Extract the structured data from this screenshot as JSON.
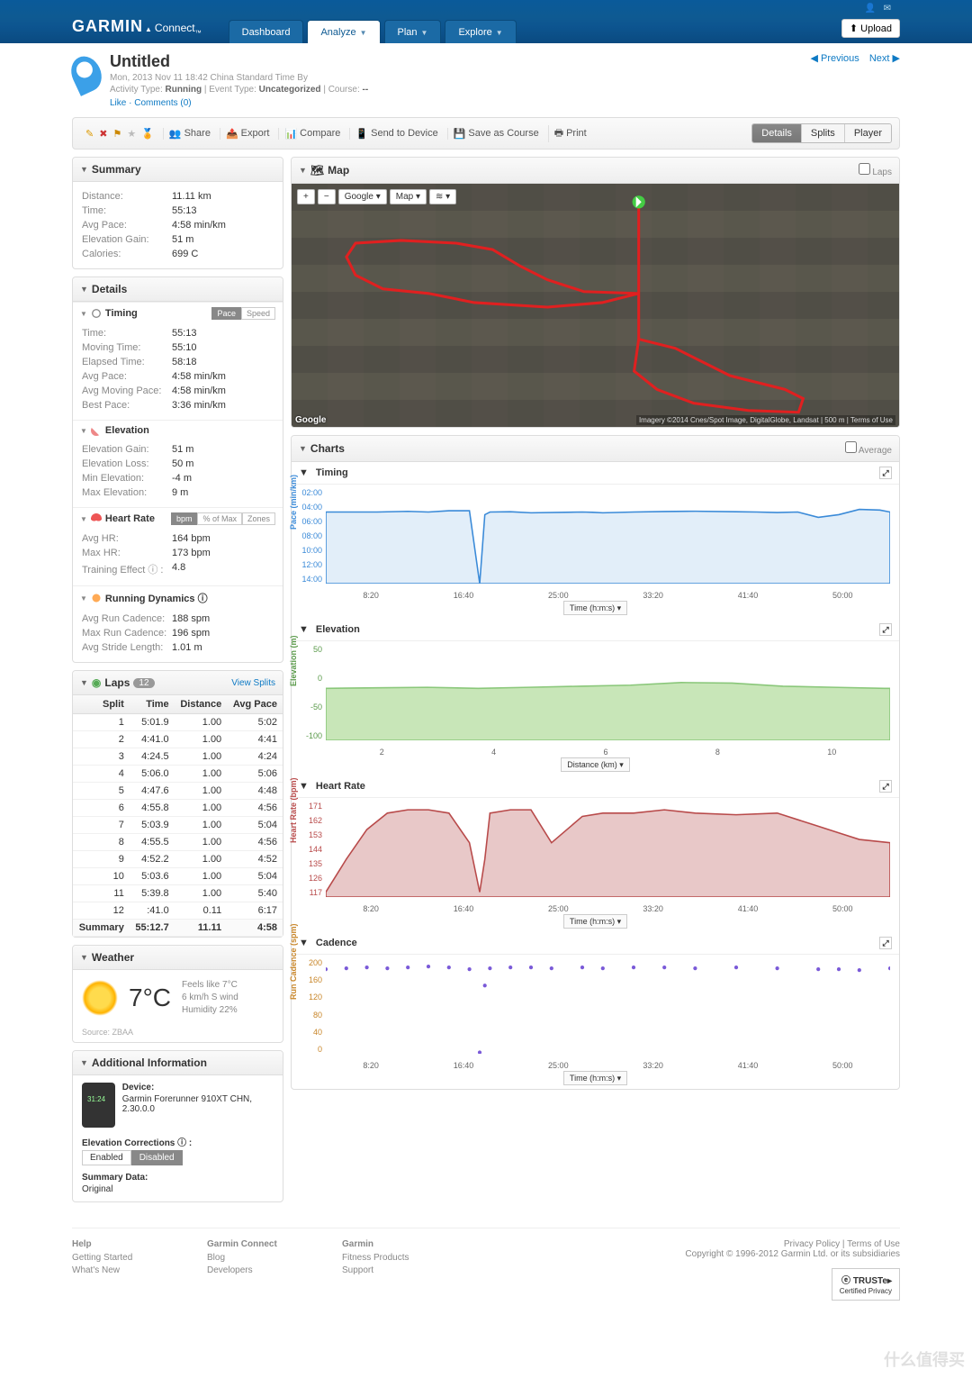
{
  "nav": {
    "dashboard": "Dashboard",
    "analyze": "Analyze",
    "plan": "Plan",
    "explore": "Explore",
    "upload": "Upload"
  },
  "header": {
    "title": "Untitled",
    "date_line": "Mon, 2013 Nov 11 18:42 China Standard Time By",
    "activity_type_lbl": "Activity Type:",
    "activity_type": "Running",
    "event_type_lbl": "Event Type:",
    "event_type": "Uncategorized",
    "course_lbl": "Course:",
    "course": "--",
    "like": "Like",
    "comments": "Comments (0)",
    "previous": "Previous",
    "next": "Next"
  },
  "toolbar": {
    "share": "Share",
    "export": "Export",
    "compare": "Compare",
    "send": "Send to Device",
    "save_course": "Save as Course",
    "print": "Print",
    "view_details": "Details",
    "view_splits": "Splits",
    "view_player": "Player"
  },
  "summary": {
    "title": "Summary",
    "rows": [
      {
        "k": "Distance:",
        "v": "11.11 km"
      },
      {
        "k": "Time:",
        "v": "55:13"
      },
      {
        "k": "Avg Pace:",
        "v": "4:58 min/km"
      },
      {
        "k": "Elevation Gain:",
        "v": "51 m"
      },
      {
        "k": "Calories:",
        "v": "699 C"
      }
    ]
  },
  "details": {
    "title": "Details",
    "timing": {
      "title": "Timing",
      "tab_pace": "Pace",
      "tab_speed": "Speed",
      "rows": [
        {
          "k": "Time:",
          "v": "55:13"
        },
        {
          "k": "Moving Time:",
          "v": "55:10"
        },
        {
          "k": "Elapsed Time:",
          "v": "58:18"
        },
        {
          "k": "Avg Pace:",
          "v": "4:58 min/km"
        },
        {
          "k": "Avg Moving Pace:",
          "v": "4:58 min/km"
        },
        {
          "k": "Best Pace:",
          "v": "3:36 min/km"
        }
      ]
    },
    "elevation": {
      "title": "Elevation",
      "rows": [
        {
          "k": "Elevation Gain:",
          "v": "51 m"
        },
        {
          "k": "Elevation Loss:",
          "v": "50 m"
        },
        {
          "k": "Min Elevation:",
          "v": "-4 m"
        },
        {
          "k": "Max Elevation:",
          "v": "9 m"
        }
      ]
    },
    "hr": {
      "title": "Heart Rate",
      "tab_bpm": "bpm",
      "tab_pct": "% of Max",
      "tab_zones": "Zones",
      "rows": [
        {
          "k": "Avg HR:",
          "v": "164 bpm"
        },
        {
          "k": "Max HR:",
          "v": "173 bpm"
        },
        {
          "k": "Training Effect ⓘ :",
          "v": "4.8"
        }
      ]
    },
    "dynamics": {
      "title": "Running Dynamics ⓘ",
      "rows": [
        {
          "k": "Avg Run Cadence:",
          "v": "188 spm"
        },
        {
          "k": "Max Run Cadence:",
          "v": "196 spm"
        },
        {
          "k": "Avg Stride Length:",
          "v": "1.01 m"
        }
      ]
    }
  },
  "laps": {
    "title": "Laps",
    "count": "12",
    "view_splits": "View Splits",
    "cols": [
      "Split",
      "Time",
      "Distance",
      "Avg Pace"
    ],
    "rows": [
      [
        "1",
        "5:01.9",
        "1.00",
        "5:02"
      ],
      [
        "2",
        "4:41.0",
        "1.00",
        "4:41"
      ],
      [
        "3",
        "4:24.5",
        "1.00",
        "4:24"
      ],
      [
        "4",
        "5:06.0",
        "1.00",
        "5:06"
      ],
      [
        "5",
        "4:47.6",
        "1.00",
        "4:48"
      ],
      [
        "6",
        "4:55.8",
        "1.00",
        "4:56"
      ],
      [
        "7",
        "5:03.9",
        "1.00",
        "5:04"
      ],
      [
        "8",
        "4:55.5",
        "1.00",
        "4:56"
      ],
      [
        "9",
        "4:52.2",
        "1.00",
        "4:52"
      ],
      [
        "10",
        "5:03.6",
        "1.00",
        "5:04"
      ],
      [
        "11",
        "5:39.8",
        "1.00",
        "5:40"
      ],
      [
        "12",
        ":41.0",
        "0.11",
        "6:17"
      ]
    ],
    "summary_row": [
      "Summary",
      "55:12.7",
      "11.11",
      "4:58"
    ]
  },
  "weather": {
    "title": "Weather",
    "temp": "7°C",
    "feels": "Feels like 7°C",
    "wind": "6 km/h S wind",
    "humidity": "Humidity 22%",
    "source": "Source: ZBAA"
  },
  "addl": {
    "title": "Additional Information",
    "device_lbl": "Device:",
    "device": "Garmin Forerunner 910XT CHN, 2.30.0.0",
    "elev_lbl": "Elevation Corrections ⓘ :",
    "enabled": "Enabled",
    "disabled": "Disabled",
    "summary_lbl": "Summary Data:",
    "summary_val": "Original"
  },
  "map": {
    "title": "Map",
    "laps": "Laps",
    "btn_plus": "+",
    "btn_minus": "−",
    "btn_google": "Google",
    "btn_map": "Map",
    "btn_layers": "≋",
    "attrib": "Imagery ©2014 Cnes/Spot Image, DigitalGlobe, Landsat | 500 m",
    "terms": "Terms of Use",
    "google_logo": "Google"
  },
  "charts": {
    "title": "Charts",
    "average": "Average",
    "timing": {
      "title": "Timing",
      "ylabel": "Pace (min/km)",
      "xlabel": "Time (h:m:s)"
    },
    "elevation": {
      "title": "Elevation",
      "ylabel": "Elevation (m)",
      "xlabel": "Distance (km)"
    },
    "hr": {
      "title": "Heart Rate",
      "ylabel": "Heart Rate (bpm)",
      "xlabel": "Time (h:m:s)"
    },
    "cadence": {
      "title": "Cadence",
      "ylabel": "Run Cadence (spm)",
      "xlabel": "Time (h:m:s)"
    }
  },
  "chart_data": [
    {
      "type": "line",
      "title": "Timing (Pace)",
      "ylabel": "Pace (min/km)",
      "xlabel": "Time (h:m:s)",
      "yticks": [
        "02:00",
        "04:00",
        "06:00",
        "08:00",
        "10:00",
        "12:00",
        "14:00"
      ],
      "xticks": [
        "8:20",
        "16:40",
        "25:00",
        "33:20",
        "41:40",
        "50:00"
      ],
      "x_minutes": [
        0,
        5,
        8,
        10,
        12,
        14,
        15,
        15.5,
        16,
        18,
        20,
        25,
        26,
        27,
        30,
        33,
        36,
        40,
        42,
        44,
        46,
        48,
        50,
        52,
        54,
        55
      ],
      "pace_sec": [
        300,
        300,
        295,
        300,
        290,
        290,
        840,
        320,
        300,
        298,
        306,
        300,
        302,
        306,
        300,
        296,
        294,
        298,
        300,
        304,
        300,
        340,
        320,
        280,
        285,
        300
      ],
      "color": "#3a8ad8"
    },
    {
      "type": "area",
      "title": "Elevation",
      "ylabel": "Elevation (m)",
      "xlabel": "Distance (km)",
      "yticks": [
        "50",
        "0",
        "-50",
        "-100"
      ],
      "xticks": [
        "2",
        "4",
        "6",
        "8",
        "10"
      ],
      "x_km": [
        0,
        1,
        2,
        3,
        4,
        5,
        6,
        7,
        8,
        9,
        10,
        11,
        11.11
      ],
      "elev_m": [
        -2,
        -1,
        0,
        -2,
        0,
        2,
        4,
        9,
        8,
        2,
        0,
        -2,
        -2
      ],
      "ylim": [
        -100,
        80
      ],
      "color": "#8ac77a",
      "fill": "#c8e6b8"
    },
    {
      "type": "line",
      "title": "Heart Rate",
      "ylabel": "Heart Rate (bpm)",
      "xlabel": "Time (h:m:s)",
      "yticks": [
        "171",
        "162",
        "153",
        "144",
        "135",
        "126",
        "117"
      ],
      "xticks": [
        "8:20",
        "16:40",
        "25:00",
        "33:20",
        "41:40",
        "50:00"
      ],
      "x_minutes": [
        0,
        2,
        4,
        6,
        8,
        10,
        12,
        14,
        15,
        15.5,
        16,
        18,
        20,
        22,
        25,
        27,
        30,
        33,
        36,
        40,
        44,
        48,
        50,
        52,
        55
      ],
      "bpm": [
        120,
        140,
        158,
        168,
        170,
        170,
        168,
        150,
        120,
        140,
        168,
        170,
        170,
        150,
        166,
        168,
        168,
        170,
        168,
        167,
        168,
        160,
        156,
        152,
        150
      ],
      "color": "#b84a4a",
      "fill": "#e8c8c8"
    },
    {
      "type": "scatter",
      "title": "Cadence",
      "ylabel": "Run Cadence (spm)",
      "xlabel": "Time (h:m:s)",
      "yticks": [
        "200",
        "160",
        "120",
        "80",
        "40",
        "0"
      ],
      "xticks": [
        "8:20",
        "16:40",
        "25:00",
        "33:20",
        "41:40",
        "50:00"
      ],
      "x_minutes": [
        0,
        2,
        4,
        6,
        8,
        10,
        12,
        14,
        15,
        15.5,
        16,
        18,
        20,
        22,
        25,
        27,
        30,
        33,
        36,
        40,
        44,
        48,
        50,
        52,
        55
      ],
      "spm": [
        186,
        188,
        190,
        188,
        190,
        192,
        190,
        186,
        3,
        150,
        188,
        190,
        190,
        188,
        190,
        188,
        190,
        190,
        188,
        190,
        188,
        186,
        186,
        184,
        188
      ],
      "color": "#7a5ad8"
    }
  ],
  "footer": {
    "help": "Help",
    "getting_started": "Getting Started",
    "whats_new": "What's New",
    "gc": "Garmin Connect",
    "blog": "Blog",
    "developers": "Developers",
    "garmin": "Garmin",
    "fitness": "Fitness Products",
    "support": "Support",
    "privacy": "Privacy Policy",
    "terms": "Terms of Use",
    "copyright": "Copyright © 1996-2012 Garmin Ltd. or its subsidiaries",
    "truste": "TRUSTe",
    "truste_sub": "Certified Privacy"
  },
  "watermark": "什么值得买"
}
